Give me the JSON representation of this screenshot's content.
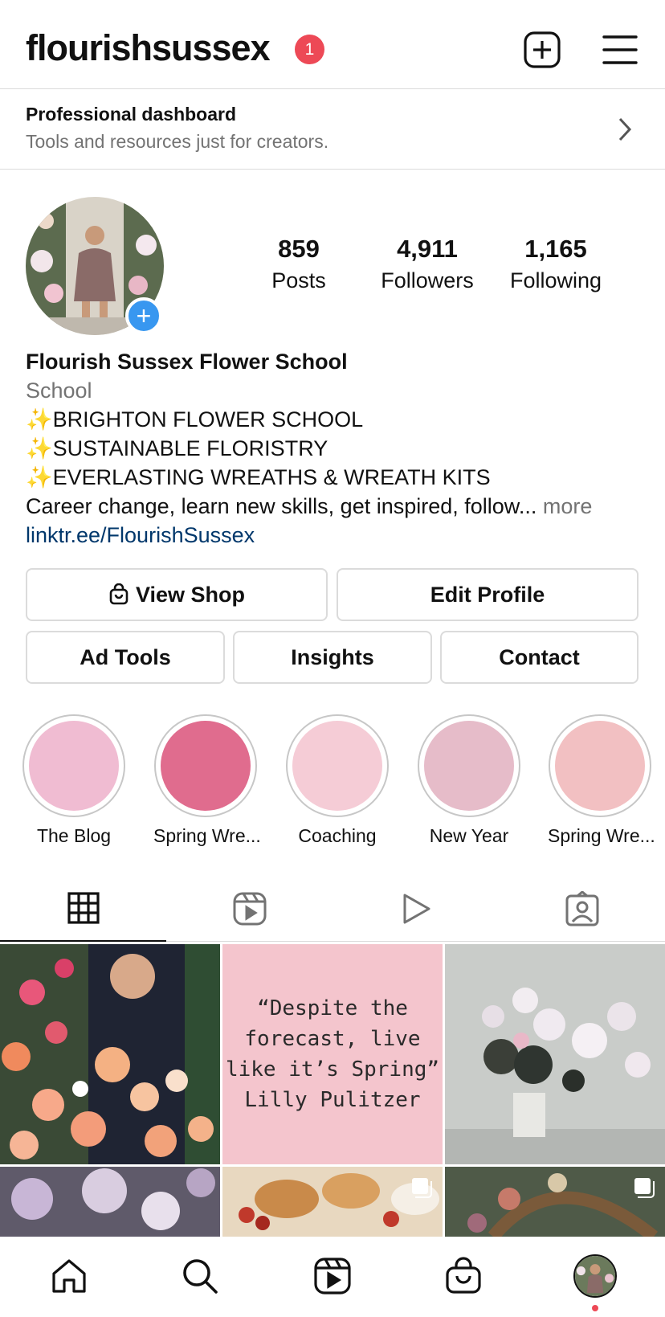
{
  "header": {
    "username": "flourishsussex",
    "notification_count": "1",
    "new_post_icon": "plus-square-icon",
    "menu_icon": "hamburger-menu-icon"
  },
  "dashboard": {
    "title": "Professional dashboard",
    "subtitle": "Tools and resources just for creators."
  },
  "profile": {
    "stats": [
      {
        "value": "859",
        "label": "Posts"
      },
      {
        "value": "4,911",
        "label": "Followers"
      },
      {
        "value": "1,165",
        "label": "Following"
      }
    ],
    "name": "Flourish Sussex Flower School",
    "category": "School",
    "bio_lines": [
      "✨BRIGHTON FLOWER SCHOOL",
      "✨SUSTAINABLE FLORISTRY",
      "✨EVERLASTING WREATHS & WREATH KITS"
    ],
    "bio_text": "Career change, learn new skills, get inspired, follow...",
    "more": "more",
    "link": "linktr.ee/FlourishSussex"
  },
  "buttons": {
    "view_shop": "View Shop",
    "edit_profile": "Edit Profile",
    "ad_tools": "Ad Tools",
    "insights": "Insights",
    "contact": "Contact"
  },
  "highlights": [
    {
      "label": "The Blog",
      "color": "#f0bcd2"
    },
    {
      "label": "Spring Wre...",
      "color": "#e06c8e"
    },
    {
      "label": "Coaching",
      "color": "#f5ccd6"
    },
    {
      "label": "New Year",
      "color": "#e6bcc9"
    },
    {
      "label": "Spring Wre...",
      "color": "#f2c0c2"
    }
  ],
  "tabs": [
    "grid-icon",
    "reels-icon",
    "video-play-icon",
    "tagged-icon"
  ],
  "posts": {
    "quote_lines": [
      "“Despite the",
      "forecast, live",
      "like it’s Spring”",
      "Lilly Pulitzer"
    ]
  },
  "colors": {
    "badge_red": "#ed4956",
    "accent_blue": "#3897f0",
    "link_blue": "#00376b"
  },
  "bottom_nav": [
    "home-icon",
    "search-icon",
    "reels-icon",
    "shop-icon",
    "profile-avatar"
  ]
}
